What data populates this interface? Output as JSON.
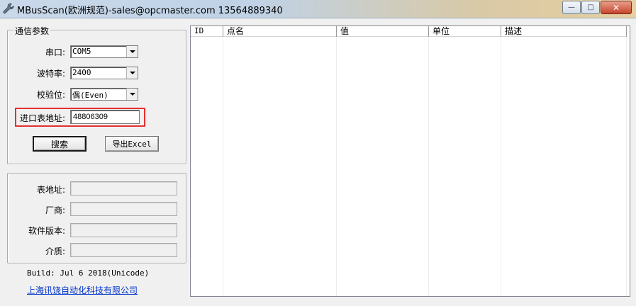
{
  "window": {
    "title": "MBusScan(欧洲规范)-sales@opcmaster.com 13564889340",
    "controls": {
      "minimize": "—",
      "maximize": "□",
      "close": "✕"
    }
  },
  "comm": {
    "group_title": "通信参数",
    "port_label": "串口:",
    "port_value": "COM5",
    "baud_label": "波特率:",
    "baud_value": "2400",
    "parity_label": "校验位:",
    "parity_value": "偶(Even)",
    "addr_label": "进口表地址:",
    "addr_value": "48806309",
    "search_button": "搜索",
    "export_button": "导出Excel"
  },
  "meter": {
    "addr_label": "表地址:",
    "vendor_label": "厂商:",
    "version_label": "软件版本:",
    "medium_label": "介质:"
  },
  "footer": {
    "build": "Build: Jul  6 2018(Unicode)",
    "company_link": "上海讯饶自动化科技有限公司"
  },
  "list": {
    "columns": [
      "ID",
      "点名",
      "值",
      "单位",
      "描述"
    ]
  },
  "colors": {
    "highlight": "#e53030",
    "link": "#0033cc"
  }
}
